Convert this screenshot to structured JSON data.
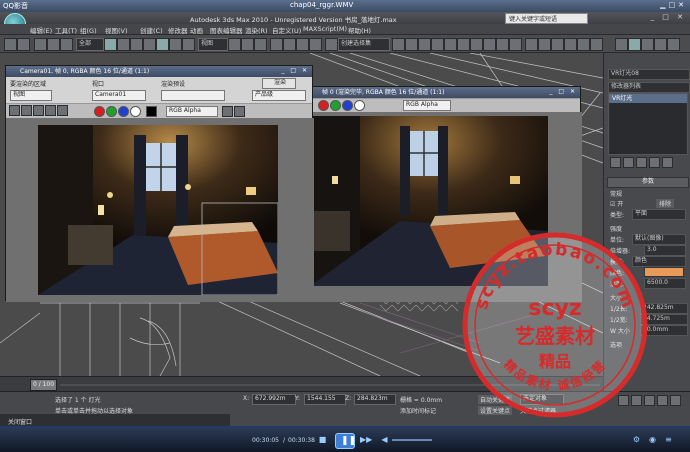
{
  "player": {
    "app_name": "QQ影音",
    "file_title": "chap04_rggr.WMV",
    "time_current": "00:30:05",
    "time_total": "00:30:38"
  },
  "max": {
    "title": "Autodesk 3ds Max 2010 - Unregistered Version 书房_落地灯.max",
    "help_search_placeholder": "键入关键字或短语",
    "menus": [
      "编辑(E)",
      "工具(T)",
      "组(G)",
      "视图(V)",
      "创建(C)",
      "修改器",
      "动画",
      "图表编辑器",
      "渲染(R)",
      "自定义(U)",
      "MAXScript(M)",
      "帮助(H)"
    ],
    "toolbar_view_select": "视图",
    "toolbar_selset": "创建选择集"
  },
  "render_window_1": {
    "title": "Camera01, 帧 0, RGBA 颜色 16 位/通道 (1:1)",
    "area_label": "要渲染的区域",
    "area_value": "视图",
    "viewport_label": "视口",
    "viewport_value": "Camera01",
    "preset_label": "渲染预设",
    "preset_value": "",
    "render_button": "渲染",
    "production_value": "产品级",
    "channel_value": "RGB Alpha"
  },
  "render_window_2": {
    "title": "帧 0 (渲染完毕, RGBA 颜色 16 位/通道 (1:1)",
    "channel_value": "RGB Alpha"
  },
  "command_panel": {
    "object_name": "VR灯光08",
    "modifier_list": "修改器列表",
    "stack_item": "VR灯光",
    "rollout_params": "参数",
    "general": "常规",
    "on_label": "开",
    "exclude": "排除",
    "type_label": "类型:",
    "type_value": "平面",
    "intensity": "强度",
    "units_label": "单位:",
    "units_value": "默认(图像)",
    "multiplier_label": "倍增器:",
    "multiplier_value": "3.0",
    "mode_label": "模式:",
    "mode_value": "颜色",
    "color_label": "颜色:",
    "temp_label": "温度:",
    "temp_value": "6500.0",
    "size": "大小",
    "half_length_label": "1/2长:",
    "half_length_value": "242.825m",
    "half_width_label": "1/2宽:",
    "half_width_value": "84.725m",
    "w_size_label": "W 大小",
    "w_size_value": "10.0mm",
    "options": "选项"
  },
  "timeline": {
    "frame": "0 / 100"
  },
  "status": {
    "selected": "选择了 1 个 灯光",
    "hint": "单击或单击并拖动以选择对象",
    "x_value": "672.992m",
    "y_value": "1544.155",
    "z_value": "284.823m",
    "grid": "栅格 = 0.0mm",
    "add_time_tag": "添加时间标记",
    "auto_key": "自动关键点",
    "set_key": "设置关键点",
    "selected_obj": "选定对象",
    "key_filter": "关键点过滤器...",
    "taskbar_item": "关闭窗口"
  },
  "watermark": {
    "line1": "scyz.taobao.com",
    "line2": "scyz",
    "line3": "艺盛素材",
    "line4": "精品",
    "ring_bottom": "精品素材 诚信经营"
  },
  "colors": {
    "accent": "#3d7fd6",
    "stamp_red": "#d62b2b",
    "swatch_red": "#d42020",
    "swatch_green": "#20a030",
    "swatch_blue": "#2040d0"
  }
}
